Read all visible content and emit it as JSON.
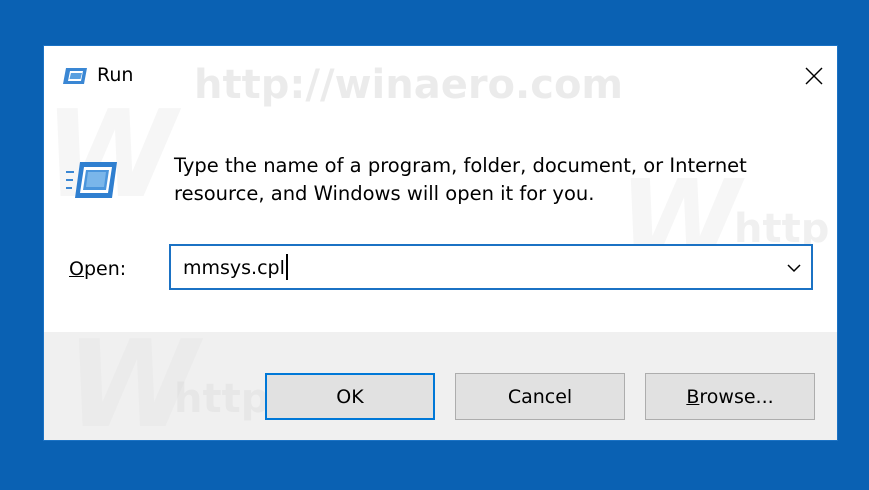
{
  "dialog": {
    "title": "Run",
    "watermark_text": "http://winaero.com",
    "watermark_letter": "W",
    "watermark_partial": "http",
    "message": "Type the name of a program, folder, document, or Internet resource, and Windows will open it for you.",
    "open_label_prefix": "",
    "open_label_mnemonic": "O",
    "open_label_rest": "pen:",
    "open_value": "mmsys.cpl",
    "buttons": {
      "ok": "OK",
      "cancel": "Cancel",
      "browse_mnemonic": "B",
      "browse_rest": "rowse..."
    }
  },
  "colors": {
    "desktop": "#0a61b3",
    "focus_border": "#0078d7",
    "footer": "#f0f0f0",
    "button_face": "#e1e1e1"
  },
  "icons": {
    "title": "run-app-icon",
    "dialog": "run-app-icon",
    "close": "close-icon",
    "dropdown": "chevron-down-icon"
  }
}
